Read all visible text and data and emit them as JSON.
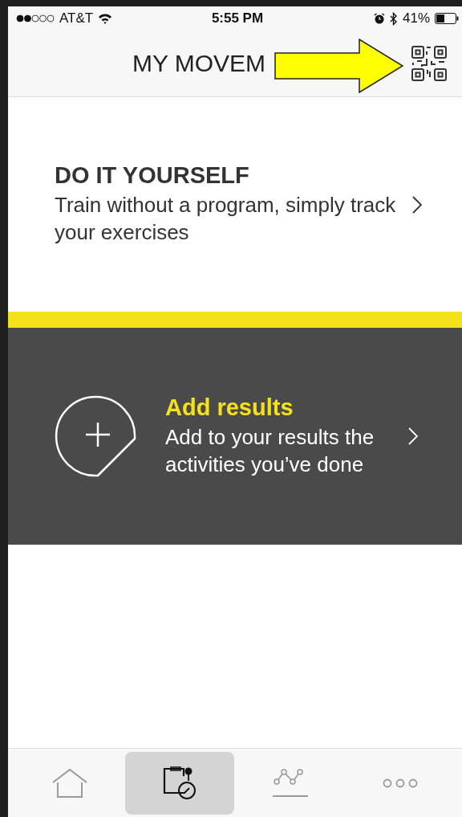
{
  "status_bar": {
    "carrier": "AT&T",
    "time": "5:55 PM",
    "battery": "41%"
  },
  "header": {
    "title": "MY MOVEM",
    "annotation_arrow": true
  },
  "cards": [
    {
      "kind": "plain",
      "title": "DO IT YOURSELF",
      "description": "Train without a program, simply track your exercises"
    },
    {
      "kind": "add",
      "title": "Add results",
      "description": "Add to your results the activities you’ve done"
    }
  ],
  "tabs": [
    {
      "kind": "home",
      "selected": false
    },
    {
      "kind": "workout",
      "selected": true
    },
    {
      "kind": "progress",
      "selected": false
    },
    {
      "kind": "more",
      "selected": false
    }
  ]
}
